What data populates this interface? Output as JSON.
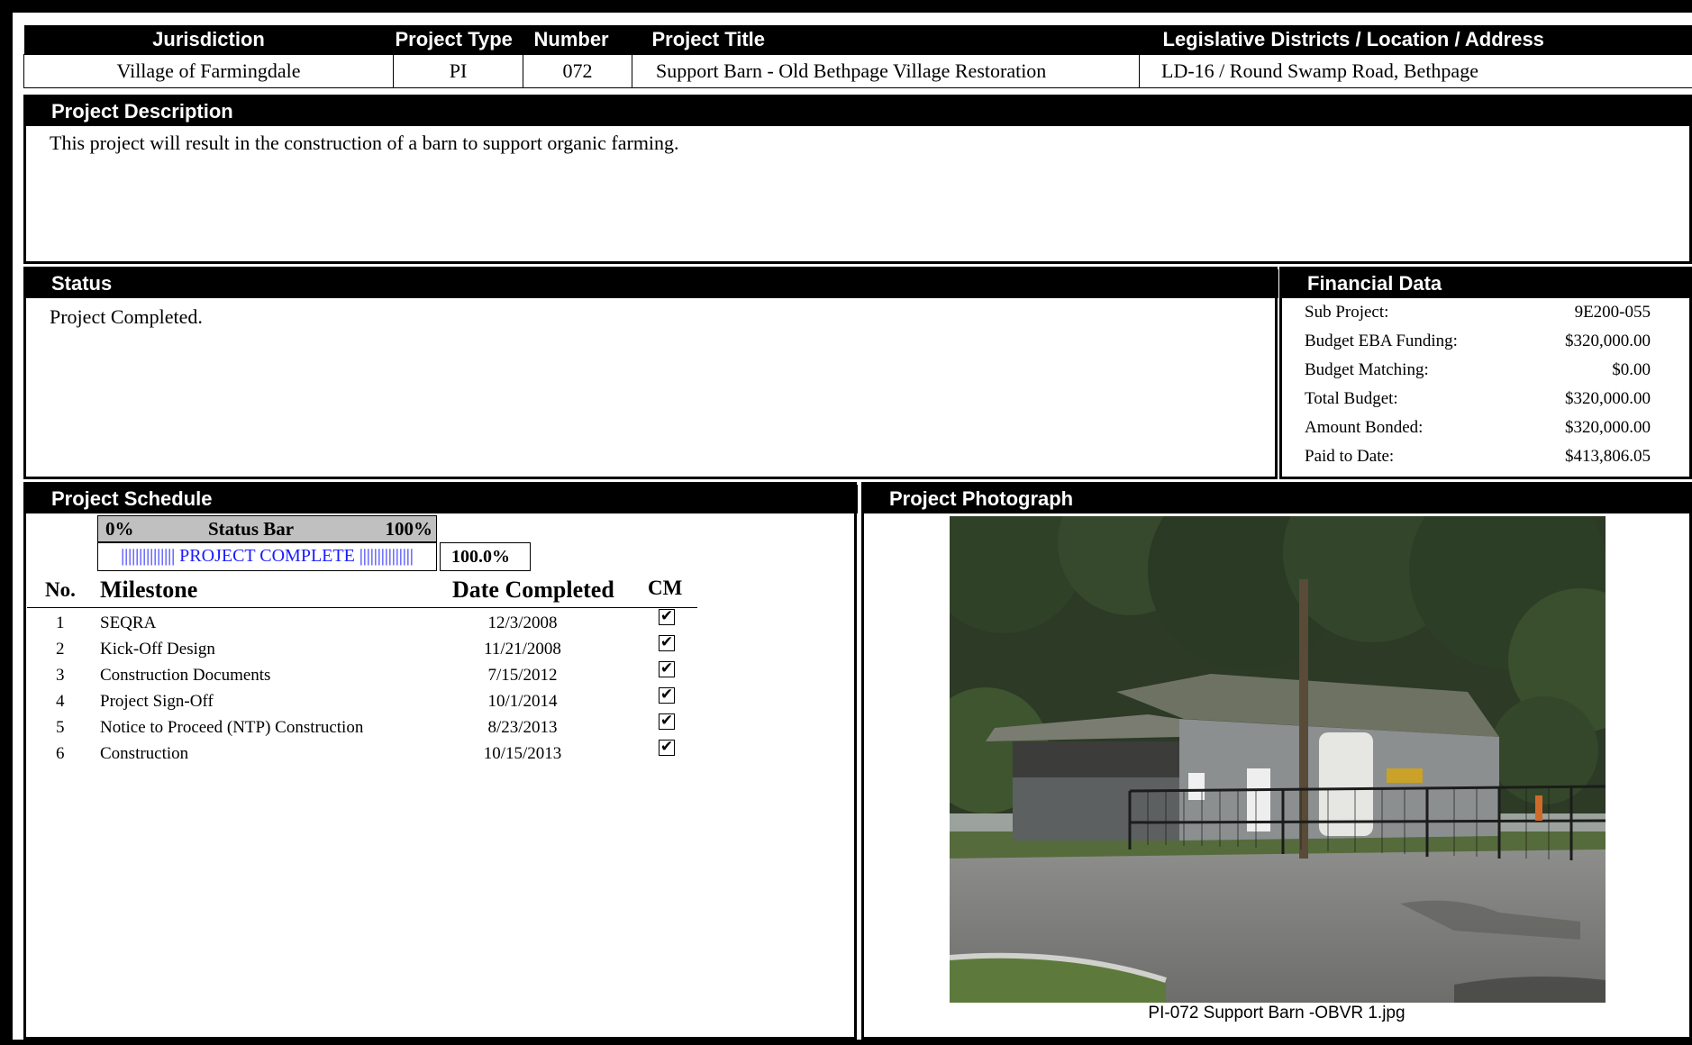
{
  "header": {
    "columns": [
      "Jurisdiction",
      "Project Type",
      "Number",
      "Project Title",
      "Legislative Districts / Location / Address"
    ],
    "values": [
      "Village of Farmingdale",
      "PI",
      "072",
      "Support Barn - Old Bethpage Village Restoration",
      "LD-16 / Round Swamp Road, Bethpage"
    ]
  },
  "description": {
    "title": "Project Description",
    "text": "This project will result in the construction of a barn to support organic farming."
  },
  "status": {
    "title": "Status",
    "text": "Project Completed."
  },
  "financial": {
    "title": "Financial Data",
    "rows": [
      {
        "label": "Sub Project:",
        "value": "9E200-055"
      },
      {
        "label": "Budget EBA Funding:",
        "value": "$320,000.00"
      },
      {
        "label": "Budget Matching:",
        "value": "$0.00"
      },
      {
        "label": "Total Budget:",
        "value": "$320,000.00"
      },
      {
        "label": "Amount Bonded:",
        "value": "$320,000.00"
      },
      {
        "label": "Paid to Date:",
        "value": "$413,806.05"
      }
    ]
  },
  "schedule": {
    "title": "Project Schedule",
    "status_bar": {
      "min_label": "0%",
      "title": "Status Bar",
      "max_label": "100%",
      "bar_text": "||||||||||||||| PROJECT COMPLETE |||||||||||||||",
      "percent_text": "100.0%",
      "progress": 1.0
    },
    "columns": {
      "no": "No.",
      "milestone": "Milestone",
      "date": "Date Completed",
      "cm": "CM"
    },
    "milestones": [
      {
        "no": "1",
        "name": "SEQRA",
        "date": "12/3/2008",
        "cm": true
      },
      {
        "no": "2",
        "name": "Kick-Off Design",
        "date": "11/21/2008",
        "cm": true
      },
      {
        "no": "3",
        "name": "Construction Documents",
        "date": "7/15/2012",
        "cm": true
      },
      {
        "no": "4",
        "name": "Project Sign-Off",
        "date": "10/1/2014",
        "cm": true
      },
      {
        "no": "5",
        "name": "Notice to Proceed (NTP) Construction",
        "date": "8/23/2013",
        "cm": true
      },
      {
        "no": "6",
        "name": "Construction",
        "date": "10/15/2013",
        "cm": true
      }
    ],
    "check_glyph": "✔"
  },
  "photo": {
    "title": "Project Photograph",
    "caption": "PI-072 Support Barn -OBVR 1.jpg"
  }
}
